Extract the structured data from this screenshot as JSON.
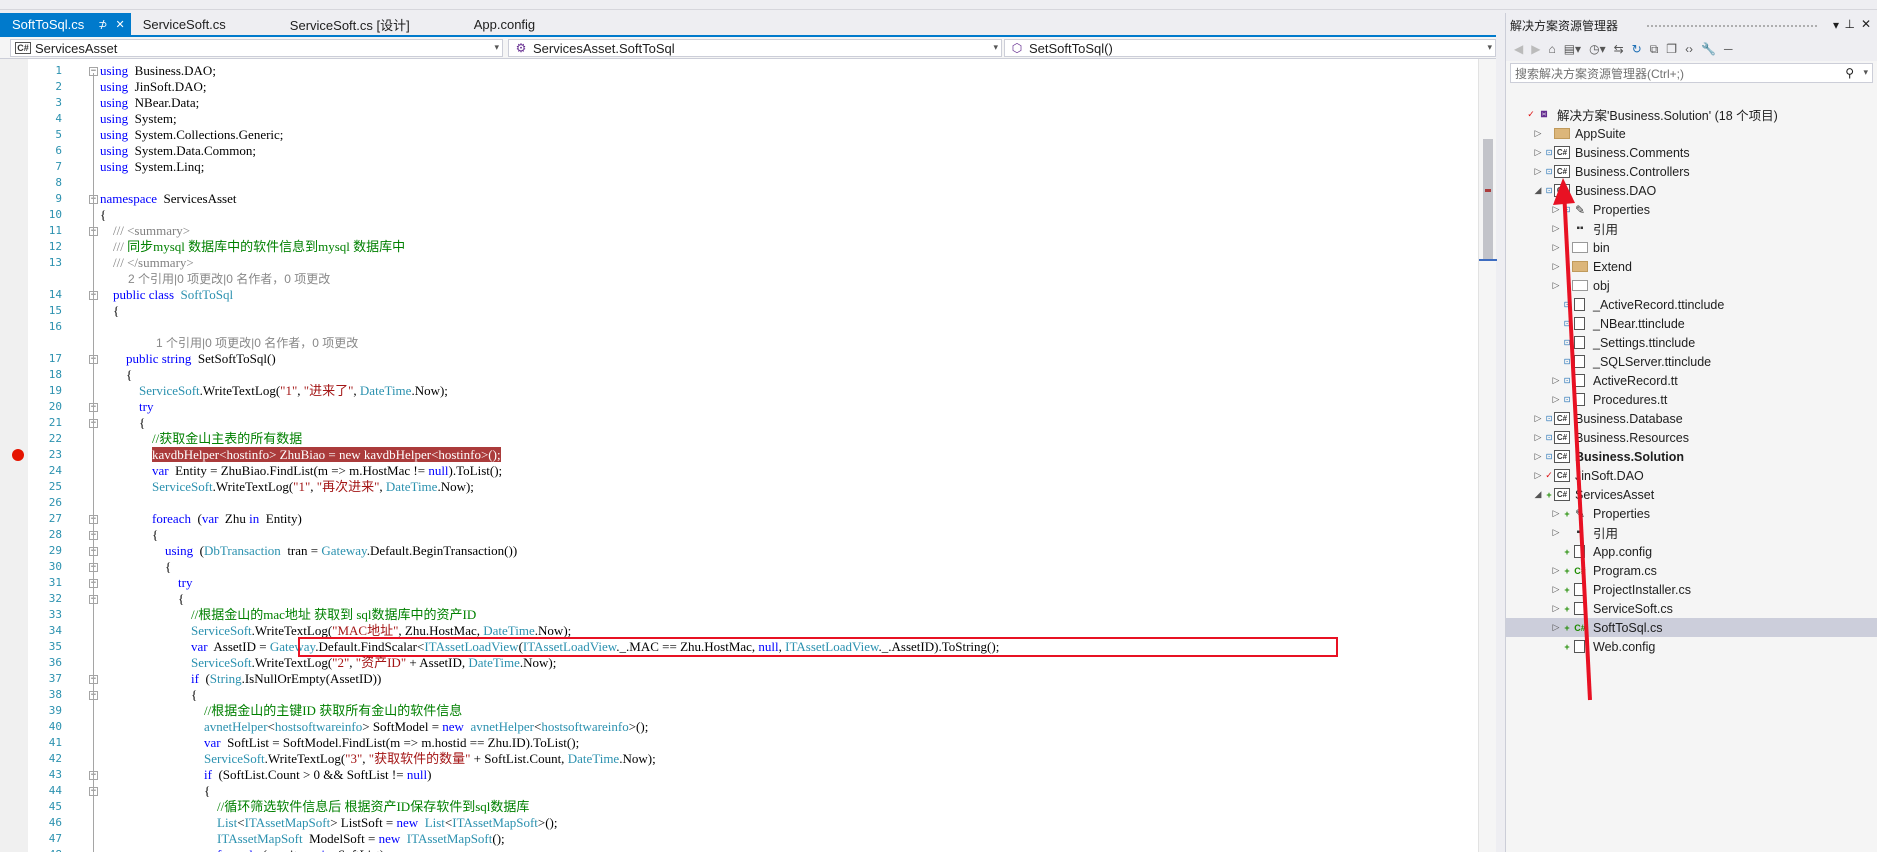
{
  "tabs": [
    {
      "label": "SoftToSql.cs",
      "active": true
    },
    {
      "label": "ServiceSoft.cs"
    },
    {
      "label": "ServiceSoft.cs [设计]"
    },
    {
      "label": "App.config"
    }
  ],
  "nav": {
    "project": "ServicesAsset",
    "class": "ServicesAsset.SoftToSql",
    "member": "SetSoftToSql()"
  },
  "code_lines": [
    {
      "n": "1",
      "segs": [
        [
          "k",
          "using"
        ],
        [
          "",
          "  Business.DAO;"
        ]
      ]
    },
    {
      "n": "2",
      "segs": [
        [
          "k",
          "using"
        ],
        [
          "",
          "  JinSoft.DAO;"
        ]
      ]
    },
    {
      "n": "3",
      "segs": [
        [
          "k",
          "using"
        ],
        [
          "",
          "  NBear.Data;"
        ]
      ]
    },
    {
      "n": "4",
      "segs": [
        [
          "k",
          "using"
        ],
        [
          "",
          "  System;"
        ]
      ]
    },
    {
      "n": "5",
      "segs": [
        [
          "k",
          "using"
        ],
        [
          "",
          "  System.Collections.Generic;"
        ]
      ]
    },
    {
      "n": "6",
      "segs": [
        [
          "k",
          "using"
        ],
        [
          "",
          "  System.Data.Common;"
        ]
      ]
    },
    {
      "n": "7",
      "segs": [
        [
          "k",
          "using"
        ],
        [
          "",
          "  System.Linq;"
        ]
      ]
    },
    {
      "n": "8",
      "segs": []
    },
    {
      "n": "9",
      "segs": [
        [
          "k",
          "namespace"
        ],
        [
          "",
          "  ServicesAsset"
        ]
      ]
    },
    {
      "n": "10",
      "segs": [
        [
          "",
          "{"
        ]
      ]
    },
    {
      "n": "11",
      "segs": [
        [
          "g",
          "    /// <summary>"
        ]
      ]
    },
    {
      "n": "12",
      "segs": [
        [
          "g",
          "    /// "
        ],
        [
          "c",
          "同步mysql 数据库中的软件信息到mysql 数据库中"
        ]
      ]
    },
    {
      "n": "13",
      "segs": [
        [
          "g",
          "    /// </summary>"
        ]
      ]
    },
    {
      "lens": "2 个引用|0 项更改|0 名作者，0 项更改"
    },
    {
      "n": "14",
      "segs": [
        [
          "",
          "    "
        ],
        [
          "k",
          "public class"
        ],
        [
          "",
          "  "
        ],
        [
          "t",
          "SoftToSql"
        ]
      ]
    },
    {
      "n": "15",
      "segs": [
        [
          "",
          "    {"
        ]
      ]
    },
    {
      "n": "16",
      "segs": []
    },
    {
      "lens": "1 个引用|0 项更改|0 名作者，0 项更改"
    },
    {
      "n": "17",
      "segs": [
        [
          "",
          "        "
        ],
        [
          "k",
          "public string"
        ],
        [
          "",
          "  SetSoftToSql()"
        ]
      ]
    },
    {
      "n": "18",
      "segs": [
        [
          "",
          "        {"
        ]
      ]
    },
    {
      "n": "19",
      "segs": [
        [
          "",
          "            "
        ],
        [
          "t",
          "ServiceSoft"
        ],
        [
          "",
          ".WriteTextLog("
        ],
        [
          "s",
          "\"1\""
        ],
        [
          "",
          ", "
        ],
        [
          "s",
          "\"进来了\""
        ],
        [
          "",
          ", "
        ],
        [
          "t",
          "DateTime"
        ],
        [
          "",
          ".Now);"
        ]
      ]
    },
    {
      "n": "20",
      "segs": [
        [
          "",
          "            "
        ],
        [
          "k",
          "try"
        ]
      ]
    },
    {
      "n": "21",
      "segs": [
        [
          "",
          "            {"
        ]
      ]
    },
    {
      "n": "22",
      "segs": [
        [
          "",
          "                "
        ],
        [
          "c",
          "//获取金山主表的所有数据"
        ]
      ]
    },
    {
      "n": "23",
      "segs": [
        [
          "",
          "                "
        ],
        [
          "hl",
          "kavdbHelper<hostinfo> ZhuBiao = new kavdbHelper<hostinfo>();"
        ]
      ]
    },
    {
      "n": "24",
      "segs": [
        [
          "",
          "                "
        ],
        [
          "k",
          "var"
        ],
        [
          "",
          "  Entity = ZhuBiao.FindList(m => m.HostMac != "
        ],
        [
          "k",
          "null"
        ],
        [
          "",
          ").ToList();"
        ]
      ]
    },
    {
      "n": "25",
      "segs": [
        [
          "",
          "                "
        ],
        [
          "t",
          "ServiceSoft"
        ],
        [
          "",
          ".WriteTextLog("
        ],
        [
          "s",
          "\"1\""
        ],
        [
          "",
          ", "
        ],
        [
          "s",
          "\"再次进来\""
        ],
        [
          "",
          ", "
        ],
        [
          "t",
          "DateTime"
        ],
        [
          "",
          ".Now);"
        ]
      ]
    },
    {
      "n": "26",
      "segs": []
    },
    {
      "n": "27",
      "segs": [
        [
          "",
          "                "
        ],
        [
          "k",
          "foreach"
        ],
        [
          "",
          "  ("
        ],
        [
          "k",
          "var"
        ],
        [
          "",
          "  Zhu "
        ],
        [
          "k",
          "in"
        ],
        [
          "",
          "  Entity)"
        ]
      ]
    },
    {
      "n": "28",
      "segs": [
        [
          "",
          "                {"
        ]
      ]
    },
    {
      "n": "29",
      "segs": [
        [
          "",
          "                    "
        ],
        [
          "k",
          "using"
        ],
        [
          "",
          "  ("
        ],
        [
          "t",
          "DbTransaction"
        ],
        [
          "",
          "  tran = "
        ],
        [
          "t",
          "Gateway"
        ],
        [
          "",
          ".Default.BeginTransaction())"
        ]
      ]
    },
    {
      "n": "30",
      "segs": [
        [
          "",
          "                    {"
        ]
      ]
    },
    {
      "n": "31",
      "segs": [
        [
          "",
          "                        "
        ],
        [
          "k",
          "try"
        ]
      ]
    },
    {
      "n": "32",
      "segs": [
        [
          "",
          "                        {"
        ]
      ]
    },
    {
      "n": "33",
      "segs": [
        [
          "",
          "                            "
        ],
        [
          "c",
          "//根据金山的mac地址 获取到 sql数据库中的资产ID"
        ]
      ]
    },
    {
      "n": "34",
      "segs": [
        [
          "",
          "                            "
        ],
        [
          "t",
          "ServiceSoft"
        ],
        [
          "",
          ".WriteTextLog("
        ],
        [
          "s",
          "\"MAC地址\""
        ],
        [
          "",
          ", Zhu.HostMac, "
        ],
        [
          "t",
          "DateTime"
        ],
        [
          "",
          ".Now);"
        ]
      ]
    },
    {
      "n": "35",
      "segs": [
        [
          "",
          "                            "
        ],
        [
          "k",
          "var"
        ],
        [
          "",
          "  AssetID = "
        ],
        [
          "t",
          "Gateway"
        ],
        [
          "",
          ".Default.FindScalar<"
        ],
        [
          "t",
          "ITAssetLoadView"
        ],
        [
          ">",
          "("
        ],
        [
          "t",
          "ITAssetLoadView"
        ],
        [
          "",
          "._.MAC == Zhu.HostMac, "
        ],
        [
          "k",
          "null"
        ],
        [
          "",
          ", "
        ],
        [
          "t",
          "ITAssetLoadView"
        ],
        [
          "",
          "._.AssetID).ToString();"
        ]
      ]
    },
    {
      "n": "36",
      "segs": [
        [
          "",
          "                            "
        ],
        [
          "t",
          "ServiceSoft"
        ],
        [
          "",
          ".WriteTextLog("
        ],
        [
          "s",
          "\"2\""
        ],
        [
          "",
          ", "
        ],
        [
          "s",
          "\"资产ID\""
        ],
        [
          "",
          " + AssetID, "
        ],
        [
          "t",
          "DateTime"
        ],
        [
          "",
          ".Now);"
        ]
      ]
    },
    {
      "n": "37",
      "segs": [
        [
          "",
          "                            "
        ],
        [
          "k",
          "if"
        ],
        [
          "",
          "  ("
        ],
        [
          "t",
          "String"
        ],
        [
          "",
          ".IsNullOrEmpty(AssetID))"
        ]
      ]
    },
    {
      "n": "38",
      "segs": [
        [
          "",
          "                            {"
        ]
      ]
    },
    {
      "n": "39",
      "segs": [
        [
          "",
          "                                "
        ],
        [
          "c",
          "//根据金山的主键ID 获取所有金山的软件信息"
        ]
      ]
    },
    {
      "n": "40",
      "segs": [
        [
          "",
          "                                "
        ],
        [
          "t",
          "avnetHelper"
        ],
        [
          "",
          "<"
        ],
        [
          "t",
          "hostsoftwareinfo"
        ],
        [
          "",
          "> SoftModel = "
        ],
        [
          "k",
          "new"
        ],
        [
          "",
          "  "
        ],
        [
          "t",
          "avnetHelper"
        ],
        [
          "",
          "<"
        ],
        [
          "t",
          "hostsoftwareinfo"
        ],
        [
          "",
          ">();"
        ]
      ]
    },
    {
      "n": "41",
      "segs": [
        [
          "",
          "                                "
        ],
        [
          "k",
          "var"
        ],
        [
          "",
          "  SoftList = SoftModel.FindList(m => m.hostid == Zhu.ID).ToList();"
        ]
      ]
    },
    {
      "n": "42",
      "segs": [
        [
          "",
          "                                "
        ],
        [
          "t",
          "ServiceSoft"
        ],
        [
          "",
          ".WriteTextLog("
        ],
        [
          "s",
          "\"3\""
        ],
        [
          "",
          ", "
        ],
        [
          "s",
          "\"获取软件的数量\""
        ],
        [
          "",
          " + SoftList.Count, "
        ],
        [
          "t",
          "DateTime"
        ],
        [
          "",
          ".Now);"
        ]
      ]
    },
    {
      "n": "43",
      "segs": [
        [
          "",
          "                                "
        ],
        [
          "k",
          "if"
        ],
        [
          "",
          "  (SoftList.Count > 0 && SoftList != "
        ],
        [
          "k",
          "null"
        ],
        [
          "",
          ")"
        ]
      ]
    },
    {
      "n": "44",
      "segs": [
        [
          "",
          "                                {"
        ]
      ]
    },
    {
      "n": "45",
      "segs": [
        [
          "",
          "                                    "
        ],
        [
          "c",
          "//循环筛选软件信息后 根据资产ID保存软件到sql数据库"
        ]
      ]
    },
    {
      "n": "46",
      "segs": [
        [
          "",
          "                                    "
        ],
        [
          "t",
          "List"
        ],
        [
          "",
          "<"
        ],
        [
          "t",
          "ITAssetMapSoft"
        ],
        [
          "",
          "> ListSoft = "
        ],
        [
          "k",
          "new"
        ],
        [
          "",
          "  "
        ],
        [
          "t",
          "List"
        ],
        [
          "",
          "<"
        ],
        [
          "t",
          "ITAssetMapSoft"
        ],
        [
          "",
          ">();"
        ]
      ]
    },
    {
      "n": "47",
      "segs": [
        [
          "",
          "                                    "
        ],
        [
          "t",
          "ITAssetMapSoft"
        ],
        [
          "",
          "  ModelSoft = "
        ],
        [
          "k",
          "new"
        ],
        [
          "",
          "  "
        ],
        [
          "t",
          "ITAssetMapSoft"
        ],
        [
          "",
          "();"
        ]
      ]
    },
    {
      "n": "48",
      "segs": [
        [
          "",
          "                                    "
        ],
        [
          "k",
          "foreach"
        ],
        [
          "",
          "  ("
        ],
        [
          "k",
          "var"
        ],
        [
          "",
          "  items "
        ],
        [
          "k",
          "in"
        ],
        [
          "",
          "  SoftList)"
        ]
      ]
    }
  ],
  "solution": {
    "title": "解决方案资源管理器",
    "search_placeholder": "搜索解决方案资源管理器(Ctrl+;)",
    "items": [
      {
        "label": "解决方案'Business.Solution' (18 个项目)",
        "icon": "sln",
        "indent": 0,
        "exp": "",
        "mk": "red"
      },
      {
        "label": "AppSuite",
        "icon": "folder",
        "indent": 1,
        "exp": "▷",
        "mk": ""
      },
      {
        "label": "Business.Comments",
        "icon": "proj",
        "indent": 1,
        "exp": "▷",
        "mk": "lock"
      },
      {
        "label": "Business.Controllers",
        "icon": "proj",
        "indent": 1,
        "exp": "▷",
        "mk": "lock"
      },
      {
        "label": "Business.DAO",
        "icon": "proj",
        "indent": 1,
        "exp": "◢",
        "mk": "lock"
      },
      {
        "label": "Properties",
        "icon": "wrench",
        "indent": 2,
        "exp": "▷",
        "mk": "lock"
      },
      {
        "label": "引用",
        "icon": "ref",
        "indent": 2,
        "exp": "▷",
        "mk": ""
      },
      {
        "label": "bin",
        "icon": "folder-empty",
        "indent": 2,
        "exp": "▷",
        "mk": ""
      },
      {
        "label": "Extend",
        "icon": "folder",
        "indent": 2,
        "exp": "▷",
        "mk": ""
      },
      {
        "label": "obj",
        "icon": "folder-empty",
        "indent": 2,
        "exp": "▷",
        "mk": ""
      },
      {
        "label": "_ActiveRecord.ttinclude",
        "icon": "file",
        "indent": 2,
        "exp": "",
        "mk": "lock"
      },
      {
        "label": "_NBear.ttinclude",
        "icon": "file",
        "indent": 2,
        "exp": "",
        "mk": "lock"
      },
      {
        "label": "_Settings.ttinclude",
        "icon": "file",
        "indent": 2,
        "exp": "",
        "mk": "lock"
      },
      {
        "label": "_SQLServer.ttinclude",
        "icon": "file",
        "indent": 2,
        "exp": "",
        "mk": "lock"
      },
      {
        "label": "ActiveRecord.tt",
        "icon": "file",
        "indent": 2,
        "exp": "▷",
        "mk": "lock"
      },
      {
        "label": "Procedures.tt",
        "icon": "file",
        "indent": 2,
        "exp": "▷",
        "mk": "lock"
      },
      {
        "label": "Business.Database",
        "icon": "proj",
        "indent": 1,
        "exp": "▷",
        "mk": "lock"
      },
      {
        "label": "Business.Resources",
        "icon": "proj",
        "indent": 1,
        "exp": "▷",
        "mk": "lock"
      },
      {
        "label": "Business.Solution",
        "icon": "proj",
        "indent": 1,
        "exp": "▷",
        "mk": "lock",
        "bold": true
      },
      {
        "label": "JinSoft.DAO",
        "icon": "proj",
        "indent": 1,
        "exp": "▷",
        "mk": "red"
      },
      {
        "label": "ServicesAsset",
        "icon": "proj",
        "indent": 1,
        "exp": "◢",
        "mk": "green"
      },
      {
        "label": "Properties",
        "icon": "wrench",
        "indent": 2,
        "exp": "▷",
        "mk": "green"
      },
      {
        "label": "引用",
        "icon": "ref",
        "indent": 2,
        "exp": "▷",
        "mk": ""
      },
      {
        "label": "App.config",
        "icon": "file",
        "indent": 2,
        "exp": "",
        "mk": "green"
      },
      {
        "label": "Program.cs",
        "icon": "cs",
        "indent": 2,
        "exp": "▷",
        "mk": "green"
      },
      {
        "label": "ProjectInstaller.cs",
        "icon": "file",
        "indent": 2,
        "exp": "▷",
        "mk": "green"
      },
      {
        "label": "ServiceSoft.cs",
        "icon": "file",
        "indent": 2,
        "exp": "▷",
        "mk": "green"
      },
      {
        "label": "SoftToSql.cs",
        "icon": "cs",
        "indent": 2,
        "exp": "▷",
        "mk": "green",
        "selected": true
      },
      {
        "label": "Web.config",
        "icon": "file",
        "indent": 2,
        "exp": "",
        "mk": "green"
      }
    ]
  },
  "colors": {
    "accent": "#007acc",
    "breakpoint": "#e51400",
    "annotation_red": "#e81123",
    "highlight": "#ab3b3b"
  }
}
